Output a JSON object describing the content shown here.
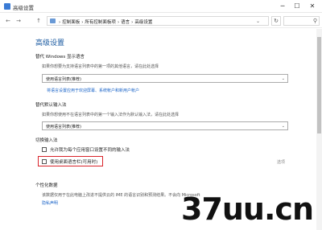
{
  "window": {
    "title": "高级设置",
    "controls": {
      "minimize": "─",
      "maximize": "☐",
      "close": "✕"
    }
  },
  "addressbar": {
    "back": "←",
    "forward": "→",
    "up": "↑",
    "crumbs": [
      "›",
      "控制面板",
      "›",
      "所有控制面板项",
      "›",
      "语言",
      "›",
      "高级设置"
    ],
    "dropdown": "⌄",
    "refresh": "↻",
    "search_icon": "⚲"
  },
  "page": {
    "heading": "高级设置",
    "windows_display_language": {
      "title": "替代 Windows 显示语言",
      "description": "如果你想要为支持语言列表中的第一项的其他语言，请在此处选择",
      "selected": "使用语言列表(推荐)",
      "link": "将语言设置应用于欢迎屏幕、系统帐户和新用户帐户"
    },
    "input_method": {
      "title": "替代默认输入法",
      "description": "如果你想使用不在语言列表中的第一个输入法作为默认输入法，请在此处选择",
      "selected": "使用语言列表(推荐)"
    },
    "switch_input": {
      "title": "切换输入法",
      "option1": "允许我为每个应用窗口设置不同的输入法",
      "option2": "使用桌面语言栏(可用时)",
      "options_link": "选项"
    },
    "personalization": {
      "title": "个性化数据",
      "description": "该数据仅用于在此电脑上改进不提供云的 IME 的语言识别和预测结果。不会向 Microsoft",
      "link": "隐私声明"
    }
  },
  "watermark": "37uu.cn",
  "colors": {
    "heading_blue": "#1a5aa0",
    "link_blue": "#1a64c8",
    "highlight_red": "#d9232a"
  }
}
